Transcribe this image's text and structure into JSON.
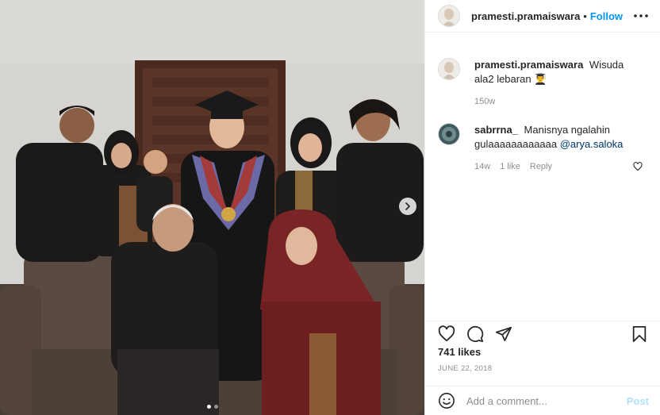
{
  "post": {
    "author": "pramesti.pramaiswara",
    "separator": "•",
    "follow_label": "Follow",
    "caption_username": "pramesti.pramaiswara",
    "caption_text": "Wisuda ala2 lebaran",
    "caption_emoji": "👨‍🎓",
    "caption_age": "150w",
    "likes": "741 likes",
    "date": "JUNE 22, 2018"
  },
  "comments": [
    {
      "username": "sabrrna_",
      "text": "Manisnya ngalahin gulaaaaaaaaaaaa",
      "mention": "@arya.saloka",
      "age": "14w",
      "likes": "1 like",
      "reply_label": "Reply"
    }
  ],
  "composer": {
    "placeholder": "Add a comment...",
    "post_label": "Post"
  },
  "carousel": {
    "total": 2,
    "active_index": 0
  },
  "icons": {
    "more": "more-horizontal-icon",
    "next": "chevron-right-icon",
    "like": "heart-icon",
    "comment": "comment-bubble-icon",
    "share": "paper-plane-icon",
    "save": "bookmark-icon",
    "emoji": "smiley-icon"
  },
  "colors": {
    "link_blue": "#0095f6",
    "post_disabled": "#b2dffc",
    "muted_text": "#8e8e8e"
  }
}
